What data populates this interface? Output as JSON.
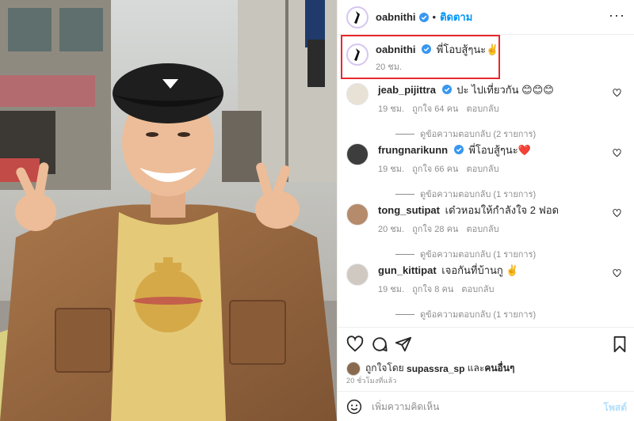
{
  "post": {
    "author": "oabnithi",
    "follow_label": "ติดตาม",
    "dot": "•",
    "more_label": "···",
    "caption": "พี่โอบสู้ๆนะ✌️",
    "caption_time": "20 ชม."
  },
  "comments": [
    {
      "user": "jeab_pijittra",
      "verified": true,
      "text": "ปะ ไปเที่ยวกัน 😊😊😊",
      "time": "19 ชม.",
      "likes": "ถูกใจ 64 คน",
      "reply_label": "ตอบกลับ",
      "replies": "ดูข้อความตอบกลับ (2 รายการ)"
    },
    {
      "user": "frungnarikunn",
      "verified": true,
      "text": "พี่โอบสู้ๆนะ❤️",
      "time": "19 ชม.",
      "likes": "ถูกใจ 66 คน",
      "reply_label": "ตอบกลับ",
      "replies": "ดูข้อความตอบกลับ (1 รายการ)"
    },
    {
      "user": "tong_sutipat",
      "verified": false,
      "text": "เด๋วหอมให้กำลังใจ 2 ฟอด",
      "time": "20 ชม.",
      "likes": "ถูกใจ 28 คน",
      "reply_label": "ตอบกลับ",
      "replies": "ดูข้อความตอบกลับ (1 รายการ)"
    },
    {
      "user": "gun_kittipat",
      "verified": false,
      "text": "เจอกันที่บ้านกู ✌️",
      "time": "19 ชม.",
      "likes": "ถูกใจ 8 คน",
      "reply_label": "ตอบกลับ",
      "replies": "ดูข้อความตอบกลับ (1 รายการ)"
    }
  ],
  "likes_line": {
    "prefix": "ถูกใจโดย",
    "user": "supassra_sp",
    "middle": "และ",
    "others": "คนอื่นๆ"
  },
  "post_time": "20 ชั่วโมงที่แล้ว",
  "add_comment": {
    "placeholder": "เพิ่มความคิดเห็น",
    "post_label": "โพสต์"
  },
  "colors": {
    "accent": "#0095f6",
    "highlight_box": "#e8282e",
    "verified": "#3897f0"
  },
  "icons": [
    "heart-icon",
    "comment-icon",
    "share-icon",
    "bookmark-icon",
    "emoji-icon",
    "verified-icon",
    "more-icon"
  ]
}
